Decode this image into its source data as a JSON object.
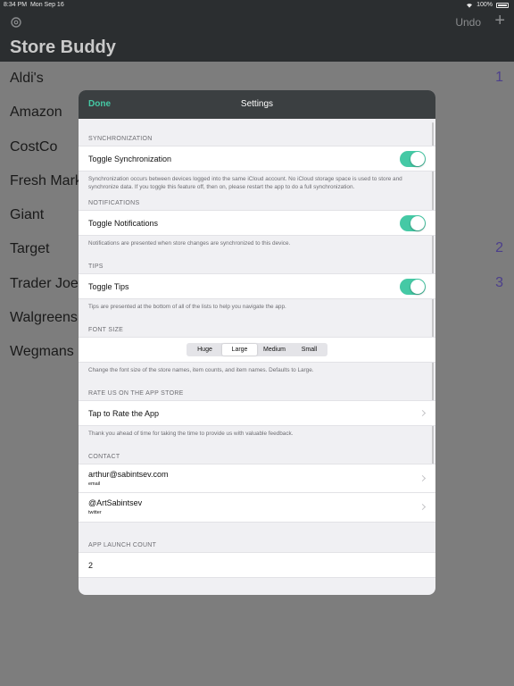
{
  "status_bar": {
    "time": "8:34 PM",
    "date": "Mon Sep 16",
    "battery": "100%"
  },
  "nav": {
    "title": "Store Buddy",
    "undo_label": "Undo",
    "add_label": "+"
  },
  "stores": [
    {
      "name": "Aldi's",
      "count": "1"
    },
    {
      "name": "Amazon",
      "count": ""
    },
    {
      "name": "CostCo",
      "count": ""
    },
    {
      "name": "Fresh Market",
      "count": ""
    },
    {
      "name": "Giant",
      "count": ""
    },
    {
      "name": "Target",
      "count": "2"
    },
    {
      "name": "Trader Joe's",
      "count": "3"
    },
    {
      "name": "Walgreens",
      "count": ""
    },
    {
      "name": "Wegmans",
      "count": ""
    }
  ],
  "settings": {
    "done_label": "Done",
    "title": "Settings",
    "sync": {
      "header": "SYNCHRONIZATION",
      "label": "Toggle Synchronization",
      "enabled": true,
      "footer": "Synchronization occurs between devices logged into the same iCloud account. No iCloud storage space is used to store and synchronize data. If you toggle this feature off, then on, please restart the app to do a full synchronization."
    },
    "notifications": {
      "header": "NOTIFICATIONS",
      "label": "Toggle Notifications",
      "enabled": true,
      "footer": "Notifications are presented when store changes are synchronized to this device."
    },
    "tips": {
      "header": "TIPS",
      "label": "Toggle Tips",
      "enabled": true,
      "footer": "Tips are presented at the bottom of all of the lists to help you navigate the app."
    },
    "font_size": {
      "header": "FONT SIZE",
      "options": [
        "Huge",
        "Large",
        "Medium",
        "Small"
      ],
      "selected": "Large",
      "footer": "Change the font size of the store names, item counts, and item names. Defaults to Large."
    },
    "rate": {
      "header": "RATE US ON THE APP STORE",
      "label": "Tap to Rate the App",
      "footer": "Thank you ahead of time for taking the time to provide us with valuable feedback."
    },
    "contact": {
      "header": "CONTACT",
      "email": {
        "value": "arthur@sabintsev.com",
        "type": "email"
      },
      "twitter": {
        "value": "@ArtSabintsev",
        "type": "twitter"
      }
    },
    "launch": {
      "header": "APP LAUNCH COUNT",
      "value": "2"
    }
  },
  "colors": {
    "accent": "#45c9a5",
    "count": "#4c3f8c",
    "bar": "#2b2e30"
  }
}
